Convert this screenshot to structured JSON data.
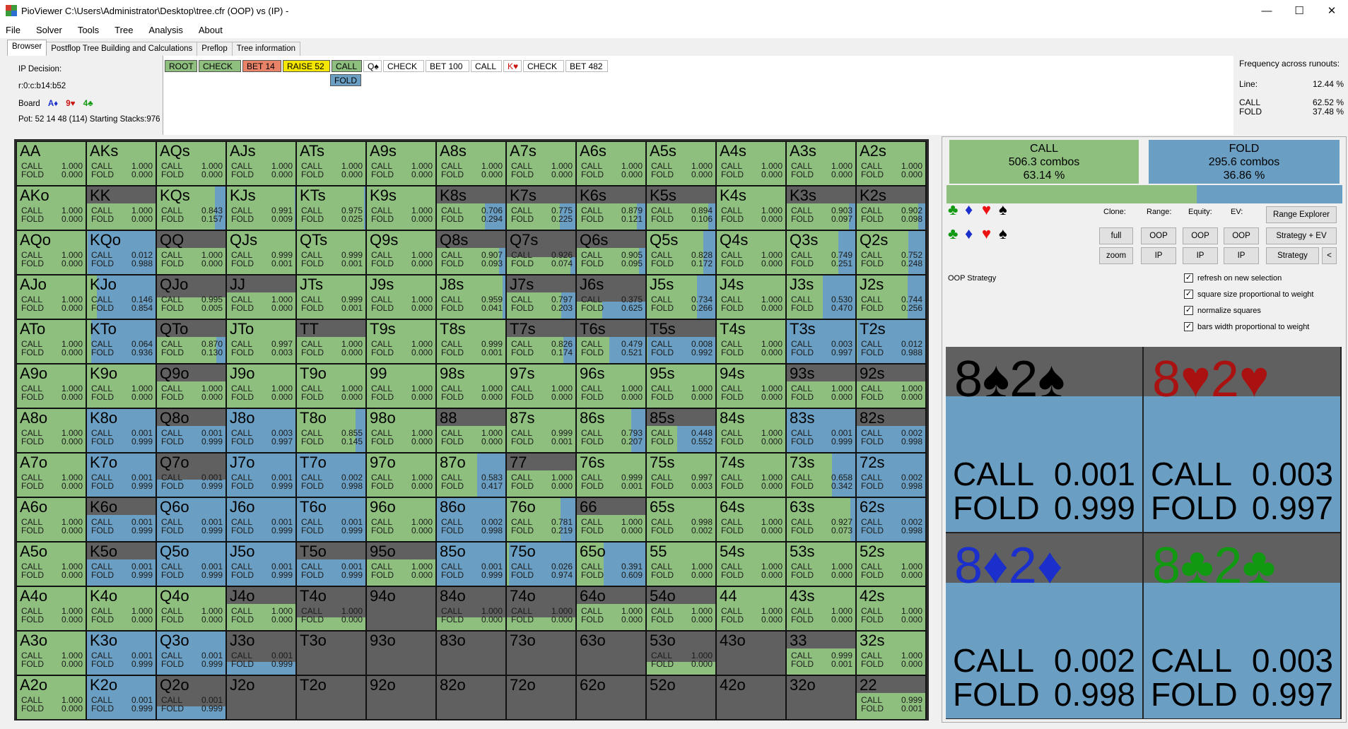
{
  "window": {
    "title": "PioViewer C:\\Users\\Administrator\\Desktop\\tree.cfr (OOP) vs (IP) -",
    "minimize": "—",
    "maximize": "☐",
    "close": "✕"
  },
  "menu": [
    "File",
    "Solver",
    "Tools",
    "Tree",
    "Analysis",
    "About"
  ],
  "tabs": [
    "Browser",
    "Postflop Tree Building and Calculations",
    "Preflop",
    "Tree information"
  ],
  "info": {
    "decision": "IP Decision:",
    "node": "r:0:c:b14:b52",
    "board_label": "Board",
    "board": [
      {
        "text": "A♦",
        "color": "#1a2fcc"
      },
      {
        "text": "9♥",
        "color": "#cc1111"
      },
      {
        "text": "4♣",
        "color": "#119911"
      }
    ],
    "pot": "Pot: 52 14 48 (114) Starting Stacks:976"
  },
  "line_nodes": [
    {
      "label": "ROOT",
      "bg": "#8ebf7e"
    },
    {
      "label": "CHECK",
      "bg": "#8ebf7e"
    },
    {
      "label": "BET 14",
      "bg": "#e8836a"
    },
    {
      "label": "RAISE 52",
      "bg": "#f5e600"
    },
    {
      "label": "CALL",
      "bg": "#8ebf7e"
    },
    {
      "label": "Q♠",
      "bg": "#ffffff"
    },
    {
      "label": "CHECK",
      "bg": "#ffffff"
    },
    {
      "label": "BET 100",
      "bg": "#ffffff"
    },
    {
      "label": "CALL",
      "bg": "#ffffff"
    },
    {
      "label": "K♥",
      "bg": "#ffffff",
      "color": "#cc1111"
    },
    {
      "label": "CHECK",
      "bg": "#ffffff"
    },
    {
      "label": "BET 482",
      "bg": "#ffffff"
    }
  ],
  "line_fold": {
    "label": "FOLD",
    "bg": "#6a9ec2"
  },
  "freq": {
    "title": "Frequency across runouts:",
    "line_label": "Line:",
    "line_value": "12.44 %",
    "call_label": "CALL",
    "call_value": "62.52 %",
    "fold_label": "FOLD",
    "fold_value": "37.48 %"
  },
  "colors": {
    "call": "#8ebf7e",
    "fold": "#6a9ec2",
    "empty": "#606060"
  },
  "grid": [
    [
      [
        "AA",
        1,
        1.0,
        0.0
      ],
      [
        "AKs",
        1,
        1.0,
        0.0
      ],
      [
        "AQs",
        1,
        1.0,
        0.0
      ],
      [
        "AJs",
        1,
        1.0,
        0.0
      ],
      [
        "ATs",
        1,
        1.0,
        0.0
      ],
      [
        "A9s",
        1,
        1.0,
        0.0
      ],
      [
        "A8s",
        1,
        1.0,
        0.0
      ],
      [
        "A7s",
        1,
        1.0,
        0.0
      ],
      [
        "A6s",
        1,
        1.0,
        0.0
      ],
      [
        "A5s",
        1,
        1.0,
        0.0
      ],
      [
        "A4s",
        1,
        1.0,
        0.0
      ],
      [
        "A3s",
        1,
        1.0,
        0.0
      ],
      [
        "A2s",
        1,
        1.0,
        0.0
      ]
    ],
    [
      [
        "AKo",
        1,
        1.0,
        0.0
      ],
      [
        "KK",
        0.6,
        1.0,
        0.0
      ],
      [
        "KQs",
        1,
        0.843,
        0.157
      ],
      [
        "KJs",
        1,
        0.991,
        0.009
      ],
      [
        "KTs",
        1,
        0.975,
        0.025
      ],
      [
        "K9s",
        1,
        1.0,
        0.0
      ],
      [
        "K8s",
        0.6,
        0.706,
        0.294
      ],
      [
        "K7s",
        0.6,
        0.775,
        0.225
      ],
      [
        "K6s",
        0.6,
        0.879,
        0.121
      ],
      [
        "K5s",
        0.6,
        0.894,
        0.106
      ],
      [
        "K4s",
        1,
        1.0,
        0.0
      ],
      [
        "K3s",
        0.6,
        0.903,
        0.097
      ],
      [
        "K2s",
        0.6,
        0.902,
        0.098
      ]
    ],
    [
      [
        "AQo",
        1,
        1.0,
        0.0
      ],
      [
        "KQo",
        1,
        0.012,
        0.988
      ],
      [
        "QQ",
        0.6,
        1.0,
        0.0
      ],
      [
        "QJs",
        1,
        0.999,
        0.001
      ],
      [
        "QTs",
        1,
        0.999,
        0.001
      ],
      [
        "Q9s",
        1,
        1.0,
        0.0
      ],
      [
        "Q8s",
        0.6,
        0.907,
        0.093
      ],
      [
        "Q7s",
        0.4,
        0.926,
        0.074
      ],
      [
        "Q6s",
        0.6,
        0.905,
        0.095
      ],
      [
        "Q5s",
        1,
        0.828,
        0.172
      ],
      [
        "Q4s",
        1,
        1.0,
        0.0
      ],
      [
        "Q3s",
        1,
        0.749,
        0.251
      ],
      [
        "Q2s",
        1,
        0.752,
        0.248
      ]
    ],
    [
      [
        "AJo",
        1,
        1.0,
        0.0
      ],
      [
        "KJo",
        1,
        0.146,
        0.854
      ],
      [
        "QJo",
        0.5,
        0.995,
        0.005
      ],
      [
        "JJ",
        0.6,
        1.0,
        0.0
      ],
      [
        "JTs",
        1,
        0.999,
        0.001
      ],
      [
        "J9s",
        1,
        1.0,
        0.0
      ],
      [
        "J8s",
        1,
        0.959,
        0.041
      ],
      [
        "J7s",
        0.6,
        0.797,
        0.203
      ],
      [
        "J6s",
        0.4,
        0.375,
        0.625
      ],
      [
        "J5s",
        1,
        0.734,
        0.266
      ],
      [
        "J4s",
        1,
        1.0,
        0.0
      ],
      [
        "J3s",
        1,
        0.53,
        0.47
      ],
      [
        "J2s",
        1,
        0.744,
        0.256
      ]
    ],
    [
      [
        "ATo",
        1,
        1.0,
        0.0
      ],
      [
        "KTo",
        1,
        0.064,
        0.936
      ],
      [
        "QTo",
        0.6,
        0.87,
        0.13
      ],
      [
        "JTo",
        1,
        0.997,
        0.003
      ],
      [
        "TT",
        0.6,
        1.0,
        0.0
      ],
      [
        "T9s",
        1,
        1.0,
        0.0
      ],
      [
        "T8s",
        1,
        0.999,
        0.001
      ],
      [
        "T7s",
        0.6,
        0.826,
        0.174
      ],
      [
        "T6s",
        0.6,
        0.479,
        0.521
      ],
      [
        "T5s",
        0.6,
        0.008,
        0.992
      ],
      [
        "T4s",
        1,
        1.0,
        0.0
      ],
      [
        "T3s",
        1,
        0.003,
        0.997
      ],
      [
        "T2s",
        1,
        0.012,
        0.988
      ]
    ],
    [
      [
        "A9o",
        1,
        1.0,
        0.0
      ],
      [
        "K9o",
        1,
        1.0,
        0.0
      ],
      [
        "Q9o",
        0.6,
        1.0,
        0.0
      ],
      [
        "J9o",
        1,
        1.0,
        0.0
      ],
      [
        "T9o",
        1,
        1.0,
        0.0
      ],
      [
        "99",
        1,
        1.0,
        0.0
      ],
      [
        "98s",
        1,
        1.0,
        0.0
      ],
      [
        "97s",
        1,
        1.0,
        0.0
      ],
      [
        "96s",
        1,
        1.0,
        0.0
      ],
      [
        "95s",
        1,
        1.0,
        0.0
      ],
      [
        "94s",
        1,
        1.0,
        0.0
      ],
      [
        "93s",
        0.6,
        1.0,
        0.0
      ],
      [
        "92s",
        0.6,
        1.0,
        0.0
      ]
    ],
    [
      [
        "A8o",
        1,
        1.0,
        0.0
      ],
      [
        "K8o",
        1,
        0.001,
        0.999
      ],
      [
        "Q8o",
        0.6,
        0.001,
        0.999
      ],
      [
        "J8o",
        1,
        0.003,
        0.997
      ],
      [
        "T8o",
        1,
        0.855,
        0.145
      ],
      [
        "98o",
        1,
        1.0,
        0.0
      ],
      [
        "88",
        0.6,
        1.0,
        0.0
      ],
      [
        "87s",
        1,
        0.999,
        0.001
      ],
      [
        "86s",
        1,
        0.793,
        0.207
      ],
      [
        "85s",
        0.6,
        0.448,
        0.552
      ],
      [
        "84s",
        1,
        1.0,
        0.0
      ],
      [
        "83s",
        1,
        0.001,
        0.999
      ],
      [
        "82s",
        0.6,
        0.002,
        0.998
      ]
    ],
    [
      [
        "A7o",
        1,
        1.0,
        0.0
      ],
      [
        "K7o",
        1,
        0.001,
        0.999
      ],
      [
        "Q7o",
        0.4,
        0.001,
        0.999
      ],
      [
        "J7o",
        1,
        0.001,
        0.999
      ],
      [
        "T7o",
        1,
        0.002,
        0.998
      ],
      [
        "97o",
        1,
        1.0,
        0.0
      ],
      [
        "87o",
        1,
        0.583,
        0.417
      ],
      [
        "77",
        0.6,
        1.0,
        0.0
      ],
      [
        "76s",
        1,
        0.999,
        0.001
      ],
      [
        "75s",
        1,
        0.997,
        0.003
      ],
      [
        "74s",
        1,
        1.0,
        0.0
      ],
      [
        "73s",
        1,
        0.658,
        0.342
      ],
      [
        "72s",
        1,
        0.002,
        0.998
      ]
    ],
    [
      [
        "A6o",
        1,
        1.0,
        0.0
      ],
      [
        "K6o",
        0.6,
        0.001,
        0.999
      ],
      [
        "Q6o",
        1,
        0.001,
        0.999
      ],
      [
        "J6o",
        1,
        0.001,
        0.999
      ],
      [
        "T6o",
        1,
        0.001,
        0.999
      ],
      [
        "96o",
        1,
        1.0,
        0.0
      ],
      [
        "86o",
        1,
        0.002,
        0.998
      ],
      [
        "76o",
        1,
        0.781,
        0.219
      ],
      [
        "66",
        0.6,
        1.0,
        0.0
      ],
      [
        "65s",
        1,
        0.998,
        0.002
      ],
      [
        "64s",
        1,
        1.0,
        0.0
      ],
      [
        "63s",
        1,
        0.927,
        0.073
      ],
      [
        "62s",
        1,
        0.002,
        0.998
      ]
    ],
    [
      [
        "A5o",
        1,
        1.0,
        0.0
      ],
      [
        "K5o",
        0.6,
        0.001,
        0.999
      ],
      [
        "Q5o",
        1,
        0.001,
        0.999
      ],
      [
        "J5o",
        1,
        0.001,
        0.999
      ],
      [
        "T5o",
        0.6,
        0.001,
        0.999
      ],
      [
        "95o",
        0.6,
        1.0,
        0.0
      ],
      [
        "85o",
        1,
        0.001,
        0.999
      ],
      [
        "75o",
        1,
        0.026,
        0.974
      ],
      [
        "65o",
        1,
        0.391,
        0.609
      ],
      [
        "55",
        1,
        1.0,
        0.0
      ],
      [
        "54s",
        1,
        1.0,
        0.0
      ],
      [
        "53s",
        1,
        1.0,
        0.0
      ],
      [
        "52s",
        1,
        1.0,
        0.0
      ]
    ],
    [
      [
        "A4o",
        1,
        1.0,
        0.0
      ],
      [
        "K4o",
        1,
        1.0,
        0.0
      ],
      [
        "Q4o",
        1,
        1.0,
        0.0
      ],
      [
        "J4o",
        0.6,
        1.0,
        0.0
      ],
      [
        "T4o",
        0.3,
        1.0,
        0.0
      ],
      [
        "94o",
        0,
        0,
        0
      ],
      [
        "84o",
        0.3,
        1.0,
        0.0
      ],
      [
        "74o",
        0.3,
        1.0,
        0.0
      ],
      [
        "64o",
        0.6,
        1.0,
        0.0
      ],
      [
        "54o",
        0.6,
        1.0,
        0.0
      ],
      [
        "44",
        1,
        1.0,
        0.0
      ],
      [
        "43s",
        1,
        1.0,
        0.0
      ],
      [
        "42s",
        1,
        1.0,
        0.0
      ]
    ],
    [
      [
        "A3o",
        1,
        1.0,
        0.0
      ],
      [
        "K3o",
        1,
        0.001,
        0.999
      ],
      [
        "Q3o",
        1,
        0.001,
        0.999
      ],
      [
        "J3o",
        0.3,
        0.001,
        0.999
      ],
      [
        "T3o",
        0,
        0,
        0
      ],
      [
        "93o",
        0,
        0,
        0
      ],
      [
        "83o",
        0,
        0,
        0
      ],
      [
        "73o",
        0,
        0,
        0
      ],
      [
        "63o",
        0,
        0,
        0
      ],
      [
        "53o",
        0.3,
        1.0,
        0.0
      ],
      [
        "43o",
        0,
        0,
        0
      ],
      [
        "33",
        0.6,
        0.999,
        0.001
      ],
      [
        "32s",
        1,
        1.0,
        0.0
      ]
    ],
    [
      [
        "A2o",
        1,
        1.0,
        0.0
      ],
      [
        "K2o",
        1,
        0.001,
        0.999
      ],
      [
        "Q2o",
        0.3,
        0.001,
        0.999
      ],
      [
        "J2o",
        0,
        0,
        0
      ],
      [
        "T2o",
        0,
        0,
        0
      ],
      [
        "92o",
        0,
        0,
        0
      ],
      [
        "82o",
        0,
        0,
        0
      ],
      [
        "72o",
        0,
        0,
        0
      ],
      [
        "62o",
        0,
        0,
        0
      ],
      [
        "52o",
        0,
        0,
        0
      ],
      [
        "42o",
        0,
        0,
        0
      ],
      [
        "32o",
        0,
        0,
        0
      ],
      [
        "22",
        0.6,
        0.999,
        0.001
      ]
    ]
  ],
  "summary": {
    "call": {
      "label": "CALL",
      "combos": "506.3 combos",
      "pct": "63.14 %",
      "fraction": 0.6314
    },
    "fold": {
      "label": "FOLD",
      "combos": "295.6 combos",
      "pct": "36.86 %"
    }
  },
  "controls": {
    "clone_label": "Clone:",
    "range_label": "Range:",
    "equity_label": "Equity:",
    "ev_label": "EV:",
    "full": "full",
    "zoom": "zoom",
    "oop": "OOP",
    "ip": "IP",
    "range_explorer": "Range Explorer",
    "strategy_ev": "Strategy + EV",
    "strategy": "Strategy",
    "collapse": "<",
    "strategy_title": "OOP Strategy"
  },
  "suits_row": [
    {
      "glyph": "♣",
      "color": "#119911"
    },
    {
      "glyph": "♦",
      "color": "#1a2fcc"
    },
    {
      "glyph": "♥",
      "color": "#ee1111"
    },
    {
      "glyph": "♠",
      "color": "#000000"
    }
  ],
  "checkboxes": [
    "refresh on new selection",
    "square size proportional to weight",
    "normalize squares",
    "bars width proportional to weight"
  ],
  "combos": [
    {
      "name": "8♠2♠",
      "color": "#000000",
      "call": "0.001",
      "fold": "0.999"
    },
    {
      "name": "8♥2♥",
      "color": "#aa1111",
      "call": "0.003",
      "fold": "0.997"
    },
    {
      "name": "8♦2♦",
      "color": "#1a2fcc",
      "call": "0.002",
      "fold": "0.998"
    },
    {
      "name": "8♣2♣",
      "color": "#119911",
      "call": "0.003",
      "fold": "0.997"
    }
  ],
  "labels": {
    "call": "CALL",
    "fold": "FOLD"
  }
}
